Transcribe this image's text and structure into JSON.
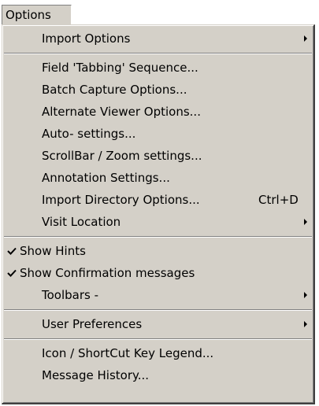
{
  "menubar": {
    "title": "Options"
  },
  "menu": {
    "items": [
      {
        "label": "Import Options",
        "submenu": true
      },
      {
        "label": "Field 'Tabbing' Sequence..."
      },
      {
        "label": "Batch Capture Options..."
      },
      {
        "label": "Alternate Viewer Options..."
      },
      {
        "label": "Auto- settings..."
      },
      {
        "label": "ScrollBar / Zoom settings..."
      },
      {
        "label": "Annotation Settings..."
      },
      {
        "label": "Import Directory Options...",
        "shortcut": "Ctrl+D"
      },
      {
        "label": "Visit Location",
        "submenu": true
      },
      {
        "label": "Show Hints",
        "checked": true
      },
      {
        "label": "Show Confirmation messages",
        "checked": true
      },
      {
        "label": "Toolbars -",
        "submenu": true
      },
      {
        "label": "User Preferences",
        "submenu": true
      },
      {
        "label": "Icon / ShortCut Key Legend..."
      },
      {
        "label": "Message History..."
      }
    ]
  },
  "icons": {
    "check": "checkmark-icon",
    "submenu": "submenu-arrow-icon"
  }
}
